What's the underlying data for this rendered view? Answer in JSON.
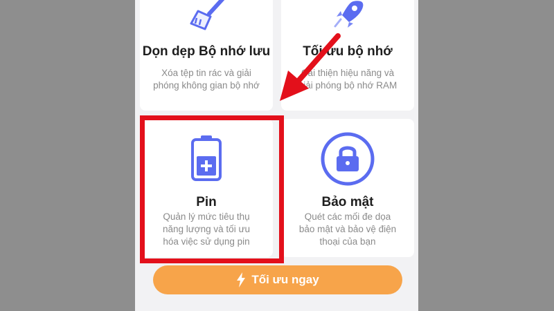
{
  "cards": {
    "storage_clean": {
      "title": "Dọn dẹp Bộ nhớ lưu",
      "description": "Xóa tệp tin rác và giải phóng không gian bộ nhớ",
      "icon": "broom-icon"
    },
    "memory_optimize": {
      "title": "Tối ưu bộ nhớ",
      "description": "Cải thiện hiệu năng và giải phóng bộ nhớ RAM",
      "icon": "rocket-icon"
    },
    "battery": {
      "title": "Pin",
      "description": "Quản lý mức tiêu thụ năng lượng và tối ưu hóa việc sử dụng pin",
      "icon": "battery-icon"
    },
    "security": {
      "title": "Bảo mật",
      "description": "Quét các mối đe dọa bảo mật và bảo vệ điện thoại của bạn",
      "icon": "lock-icon"
    }
  },
  "optimize_button": {
    "label": "Tối ưu ngay",
    "icon": "lightning-icon"
  },
  "colors": {
    "accent_blue": "#5b6cf0",
    "highlight_red": "#e3101b",
    "button_orange": "#f7a44a"
  }
}
